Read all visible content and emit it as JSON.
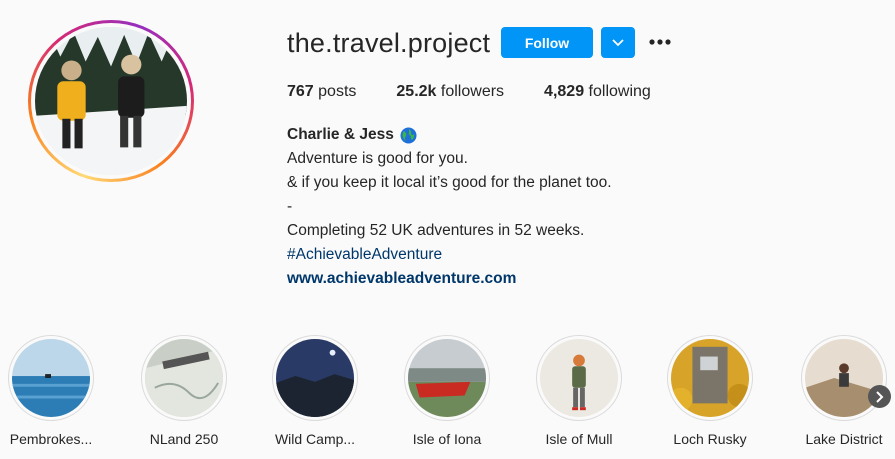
{
  "profile": {
    "username": "the.travel.project",
    "follow_label": "Follow",
    "avatar_alt": "Charlie & Jess in snow"
  },
  "stats": {
    "posts_count": "767",
    "posts_label": "posts",
    "followers_count": "25.2k",
    "followers_label": "followers",
    "following_count": "4,829",
    "following_label": "following"
  },
  "bio": {
    "name": "Charlie & Jess",
    "line1": "Adventure is good for you.",
    "line2": "& if you keep it local it’s good for the planet too.",
    "line3": "-",
    "line4": "Completing 52 UK adventures in 52 weeks.",
    "hashtag": "#AchievableAdventure",
    "website": "www.achievableadventure.com"
  },
  "highlights": [
    {
      "label": "Pembrokes..."
    },
    {
      "label": "NLand 250"
    },
    {
      "label": "Wild Camp..."
    },
    {
      "label": "Isle of Iona"
    },
    {
      "label": "Isle of Mull"
    },
    {
      "label": "Loch Rusky"
    },
    {
      "label": "Lake District"
    }
  ],
  "colors": {
    "accent": "#0095f6",
    "link": "#00376b"
  }
}
